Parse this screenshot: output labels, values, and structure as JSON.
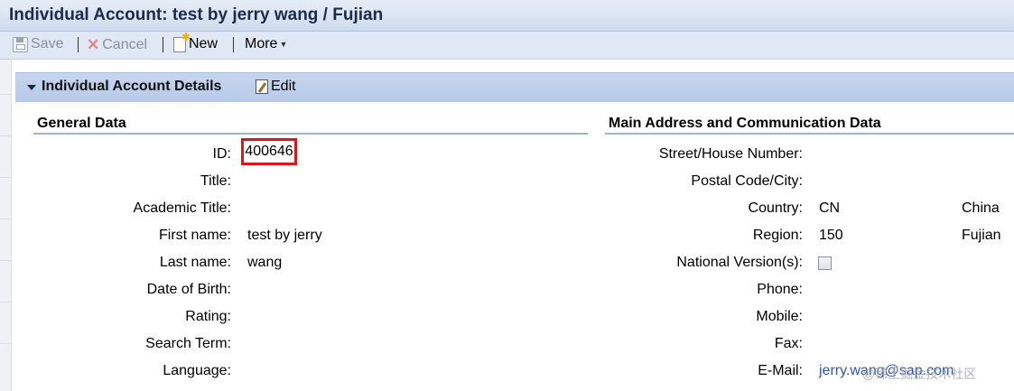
{
  "window": {
    "title": "Individual Account: test by jerry wang / Fujian"
  },
  "toolbar": {
    "save_label": "Save",
    "cancel_label": "Cancel",
    "new_label": "New",
    "more_label": "More"
  },
  "panel": {
    "title": "Individual Account Details",
    "edit_label": "Edit"
  },
  "general_data": {
    "heading": "General Data",
    "fields": [
      {
        "label": "ID:",
        "value": "400646"
      },
      {
        "label": "Title:",
        "value": ""
      },
      {
        "label": "Academic Title:",
        "value": ""
      },
      {
        "label": "First name:",
        "value": "test by jerry"
      },
      {
        "label": "Last name:",
        "value": "wang"
      },
      {
        "label": "Date of Birth:",
        "value": ""
      },
      {
        "label": "Rating:",
        "value": ""
      },
      {
        "label": "Search Term:",
        "value": ""
      },
      {
        "label": "Language:",
        "value": ""
      }
    ]
  },
  "address_data": {
    "heading": "Main Address and Communication Data",
    "fields": [
      {
        "label": "Street/House Number:",
        "value": "",
        "desc": ""
      },
      {
        "label": "Postal Code/City:",
        "value": "",
        "desc": ""
      },
      {
        "label": "Country:",
        "value": "CN",
        "desc": "China"
      },
      {
        "label": "Region:",
        "value": "150",
        "desc": "Fujian"
      },
      {
        "label": "National Version(s):",
        "value": "",
        "desc": ""
      },
      {
        "label": "Phone:",
        "value": "",
        "desc": ""
      },
      {
        "label": "Mobile:",
        "value": "",
        "desc": ""
      },
      {
        "label": "Fax:",
        "value": "",
        "desc": ""
      },
      {
        "label": "E-Mail:",
        "value": "jerry.wang@sap.com",
        "desc": ""
      }
    ]
  },
  "watermark": "@稀土掘金技术社区",
  "colors": {
    "highlight_border": "#e0151c",
    "link": "#2f56b5",
    "panel_header": "#c7d6ef"
  }
}
